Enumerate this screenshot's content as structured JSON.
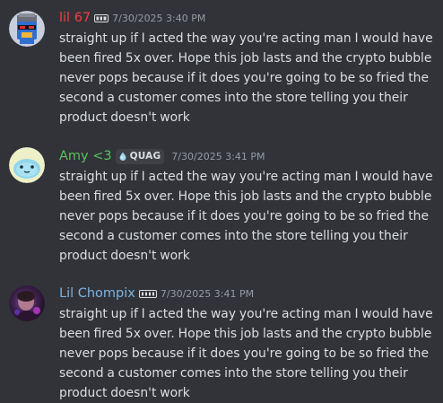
{
  "messages": [
    {
      "author": "lil 67",
      "author_color": "#f23f43",
      "timestamp": "7/30/2025 3:40 PM",
      "text": "straight up if I acted the way you're acting man I would have been fired 5x over. Hope this job lasts and the crypto bubble never pops because if it does you're going to be so fried the second a customer comes into the store telling you their product doesn't work",
      "avatar_icon": "blue-penguin-sunglasses-avatar",
      "badge_icon": "server-tag-icon"
    },
    {
      "author": "Amy <3",
      "author_color": "#57c25f",
      "tag": "QUAG",
      "timestamp": "7/30/2025 3:41 PM",
      "text": "straight up if I acted the way you're acting man I would have been fired 5x over. Hope this job lasts and the crypto bubble never pops because if it does you're going to be so fried the second a customer comes into the store telling you their product doesn't work",
      "avatar_icon": "blue-ghost-avatar",
      "badge_icon": "droplet-icon"
    },
    {
      "author": "Lil Chompix",
      "author_color": "#7fb3e0",
      "timestamp": "7/30/2025 3:41 PM",
      "text": "straight up if I acted the way you're acting man I would have been fired 5x over. Hope this job lasts and the crypto bubble never pops because if it does you're going to be so fried the second a customer comes into the store telling you their product doesn't work",
      "avatar_icon": "purple-photo-avatar",
      "badge_icon": "server-tag-icon"
    }
  ]
}
